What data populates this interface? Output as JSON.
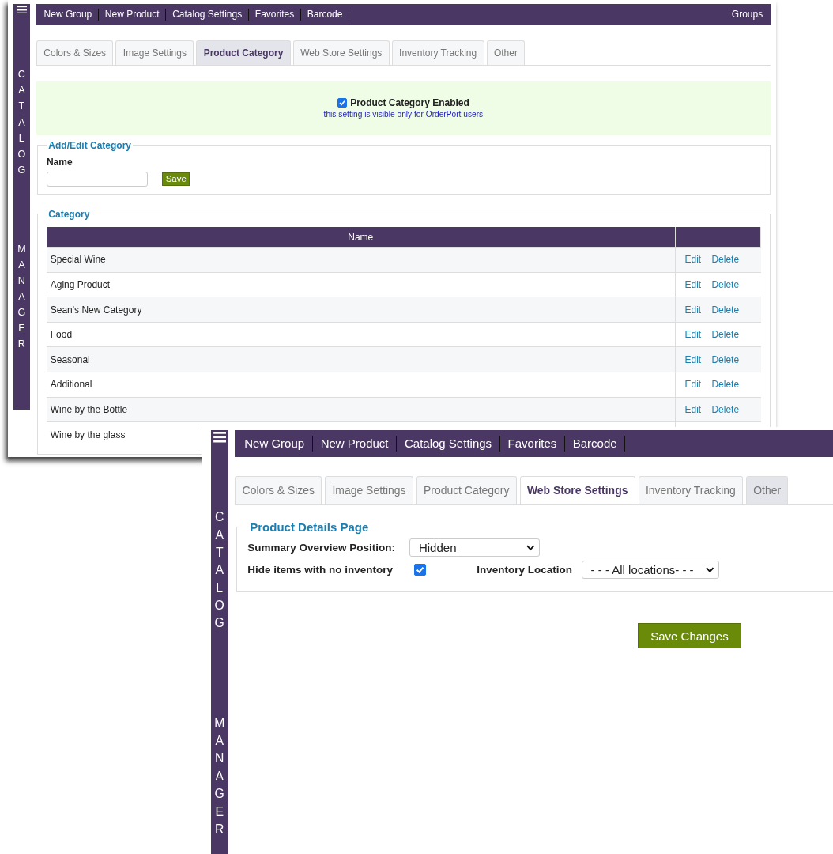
{
  "windows": [
    {
      "kind": "category",
      "sidebar": {
        "top": "CATALOG",
        "bottom": "MANAGER"
      },
      "nav": [
        "New Group",
        "New Product",
        "Catalog Settings",
        "Favorites",
        "Barcode"
      ],
      "nav_right": "Groups",
      "tabs": [
        {
          "label": "Colors & Sizes",
          "selected": false,
          "highlighted": false
        },
        {
          "label": "Image Settings",
          "selected": false,
          "highlighted": false
        },
        {
          "label": "Product Category",
          "selected": true,
          "highlighted": true
        },
        {
          "label": "Web Store Settings",
          "selected": false,
          "highlighted": false
        },
        {
          "label": "Inventory Tracking",
          "selected": false,
          "highlighted": false
        },
        {
          "label": "Other",
          "selected": false,
          "highlighted": false
        }
      ],
      "notice": {
        "checked": true,
        "label": "Product Category Enabled",
        "note": "this setting is visible only for OrderPort users"
      },
      "edit_section": {
        "legend": "Add/Edit Category",
        "field_label": "Name",
        "button": "Save"
      },
      "list_section": {
        "legend": "Category",
        "columns": [
          "Name"
        ],
        "rows": [
          {
            "name": "Special Wine",
            "actions": [
              "Edit",
              "Delete"
            ]
          },
          {
            "name": "Aging Product",
            "actions": [
              "Edit",
              "Delete"
            ]
          },
          {
            "name": "Sean's New Category",
            "actions": [
              "Edit",
              "Delete"
            ]
          },
          {
            "name": "Food",
            "actions": [
              "Edit",
              "Delete"
            ]
          },
          {
            "name": "Seasonal",
            "actions": [
              "Edit",
              "Delete"
            ]
          },
          {
            "name": "Additional",
            "actions": [
              "Edit",
              "Delete"
            ]
          },
          {
            "name": "Wine by the Bottle",
            "actions": [
              "Edit",
              "Delete"
            ]
          },
          {
            "name": "Wine by the glass"
          }
        ]
      }
    },
    {
      "kind": "webstore",
      "sidebar": {
        "top": "CATALOG",
        "bottom": "MANAGER"
      },
      "nav": [
        "New Group",
        "New Product",
        "Catalog Settings",
        "Favorites",
        "Barcode"
      ],
      "tabs": [
        {
          "label": "Colors & Sizes",
          "selected": false,
          "highlighted": false
        },
        {
          "label": "Image Settings",
          "selected": false,
          "highlighted": false
        },
        {
          "label": "Product Category",
          "selected": false,
          "highlighted": false
        },
        {
          "label": "Web Store Settings",
          "selected": true,
          "highlighted": false
        },
        {
          "label": "Inventory Tracking",
          "selected": false,
          "highlighted": false
        },
        {
          "label": "Other",
          "selected": false,
          "highlighted": true
        }
      ],
      "form": {
        "legend": "Product Details Page",
        "rows": [
          {
            "fields": [
              {
                "kind": "select",
                "label": "Summary Overview Position:",
                "value": "Hidden"
              }
            ]
          },
          {
            "fields": [
              {
                "kind": "checkbox",
                "label": "Hide items with no inventory",
                "checked": true
              },
              {
                "kind": "select",
                "label": "Inventory Location",
                "value": "- - - All locations- - -"
              }
            ]
          }
        ]
      },
      "button": "Save Changes"
    }
  ]
}
